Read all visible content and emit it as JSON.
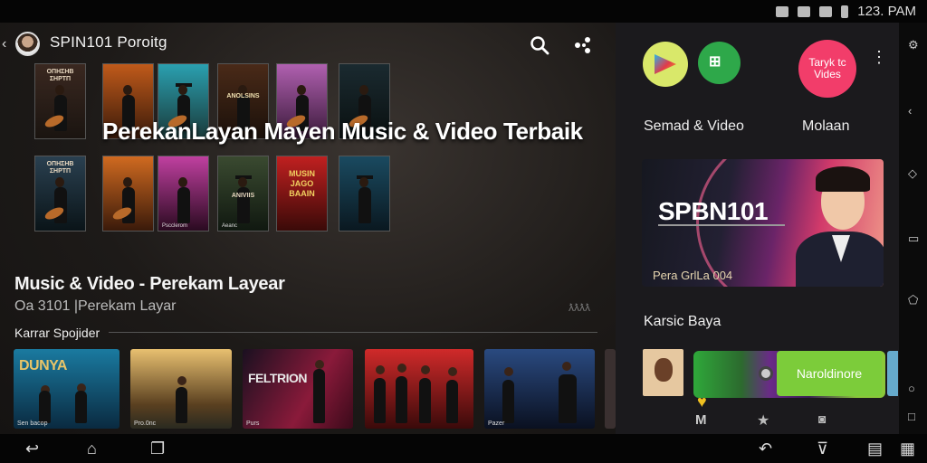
{
  "status_bar": {
    "time": "123. PAM"
  },
  "header": {
    "app_title": "SPIN101  Poroitg"
  },
  "posters_row1": [
    {
      "caption": "ΟΠΗΣΗΒ ΣΗΡΤΠ",
      "footer": ""
    },
    {
      "caption": "",
      "footer": ""
    },
    {
      "caption": "",
      "footer": ""
    },
    {
      "caption": "ANOLSINS",
      "footer": ""
    },
    {
      "caption": "",
      "footer": ""
    },
    {
      "caption": "",
      "footer": ""
    }
  ],
  "posters_row2": [
    {
      "caption": "ΟΠΗΣΗΒ ΣΗΡΤΠ",
      "footer": ""
    },
    {
      "caption": "",
      "footer": ""
    },
    {
      "caption": "",
      "footer": "Pscclerom"
    },
    {
      "caption": "ANIVIIS",
      "footer": "Aeanc"
    },
    {
      "caption": "MUSIN JAGO BAAIN",
      "footer": ""
    },
    {
      "caption": "",
      "footer": ""
    }
  ],
  "overlay_title": "PerekanLayan Mayen Music & Video Terbaik",
  "section": {
    "title": "Music & Video - Perekam Layear",
    "subtitle": "Oa 3101  |Perekam Layar",
    "mark": "ƛƛƛƛ",
    "row_label": "Karrar Spojider"
  },
  "tiles": [
    {
      "title": "DUNYA",
      "footer": "Sen bacop"
    },
    {
      "title": "",
      "footer": "Pro.0nc"
    },
    {
      "title": "FELTRION",
      "footer": "Purs"
    },
    {
      "title": "",
      "footer": ""
    },
    {
      "title": "",
      "footer": "Pazer"
    }
  ],
  "side": {
    "circle2_label": "⊞",
    "circle3_line1": "Taryk tc",
    "circle3_line2": "Vides",
    "label_left": "Semad & Video",
    "label_right": "Molaan",
    "banner_title": "SPBN101",
    "banner_date": "Pera GrlLa 004",
    "label_mid": "Karsic Baya",
    "green_button": "Naroldinore"
  },
  "colors": {
    "accent_pink": "#f23d6a",
    "accent_green": "#7ccc3a",
    "accent_yellow": "#d9e86a"
  }
}
